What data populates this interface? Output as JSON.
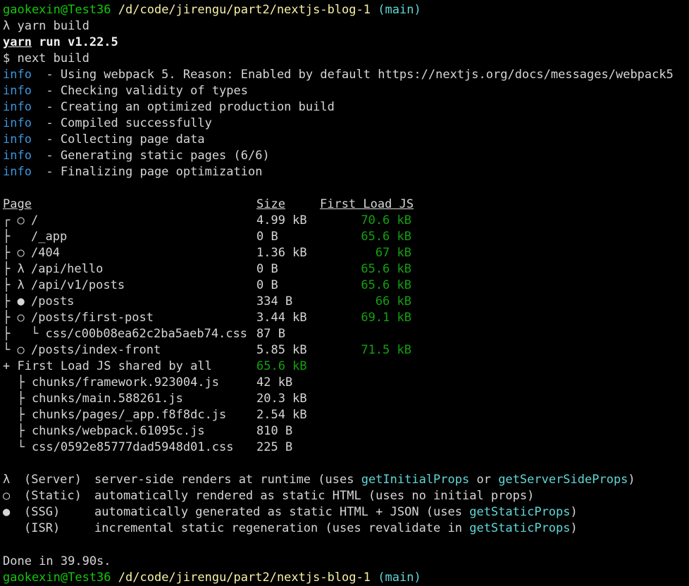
{
  "prompt1": {
    "user": "gaokexin@Test36",
    "path": "/d/code/jirengu/part2/nextjs-blog-1",
    "branch": "(main)"
  },
  "command": "λ yarn build",
  "yarn_version": {
    "word": "yarn",
    "rest": " run v1.22.5"
  },
  "next_cmd": "$ next build",
  "info_label": "info",
  "info_lines": [
    "  - Using webpack 5. Reason: Enabled by default https://nextjs.org/docs/messages/webpack5",
    "  - Checking validity of types",
    "  - Creating an optimized production build",
    "  - Compiled successfully",
    "  - Collecting page data",
    "  - Generating static pages (6/6)",
    "  - Finalizing page optimization"
  ],
  "table": {
    "headers": {
      "page": "Page",
      "size": "Size",
      "first_load": "First Load JS"
    },
    "rows": [
      {
        "tree": "┌ ○ ",
        "page": "/",
        "size": "4.99 kB",
        "load": "70.6 kB"
      },
      {
        "tree": "├   ",
        "page": "/_app",
        "size": "0 B",
        "load": "65.6 kB"
      },
      {
        "tree": "├ ○ ",
        "page": "/404",
        "size": "1.36 kB",
        "load": "67 kB"
      },
      {
        "tree": "├ λ ",
        "page": "/api/hello",
        "size": "0 B",
        "load": "65.6 kB"
      },
      {
        "tree": "├ λ ",
        "page": "/api/v1/posts",
        "size": "0 B",
        "load": "65.6 kB"
      },
      {
        "tree": "├ ● ",
        "page": "/posts",
        "size": "334 B",
        "load": "66 kB"
      },
      {
        "tree": "├ ○ ",
        "page": "/posts/first-post",
        "size": "3.44 kB",
        "load": "69.1 kB"
      },
      {
        "tree": "├   ",
        "page": "└ css/c00b08ea62c2ba5aeb74.css",
        "size": "87 B",
        "load": ""
      },
      {
        "tree": "└ ○ ",
        "page": "/posts/index-front",
        "size": "5.85 kB",
        "load": "71.5 kB"
      }
    ],
    "shared_label": "+ First Load JS shared by all",
    "shared_size": "65.6 kB",
    "chunks": [
      {
        "name": "  ├ chunks/framework.923004.js",
        "size": "42 kB"
      },
      {
        "name": "  ├ chunks/main.588261.js",
        "size": "20.3 kB"
      },
      {
        "name": "  ├ chunks/pages/_app.f8f8dc.js",
        "size": "2.54 kB"
      },
      {
        "name": "  ├ chunks/webpack.61095c.js",
        "size": "810 B"
      },
      {
        "name": "  └ css/0592e85777dad5948d01.css",
        "size": "225 B"
      }
    ]
  },
  "legend": [
    {
      "sym": "λ",
      "kind": "(Server)",
      "desc": "server-side renders at runtime (uses ",
      "link1": "getInitialProps",
      "mid": " or ",
      "link2": "getServerSideProps",
      "end": ")"
    },
    {
      "sym": "○",
      "kind": "(Static)",
      "desc": "automatically rendered as static HTML (uses no initial props)",
      "link1": "",
      "mid": "",
      "link2": "",
      "end": ""
    },
    {
      "sym": "●",
      "kind": "(SSG)",
      "desc": "automatically generated as static HTML + JSON (uses ",
      "link1": "getStaticProps",
      "mid": "",
      "link2": "",
      "end": ")"
    },
    {
      "sym": " ",
      "kind": "(ISR)",
      "desc": "incremental static regeneration (uses revalidate in ",
      "link1": "getStaticProps",
      "mid": "",
      "link2": "",
      "end": ")"
    }
  ],
  "done": "Done in 39.90s.",
  "prompt2": {
    "user": "gaokexin@Test36",
    "path": "/d/code/jirengu/part2/nextjs-blog-1",
    "branch": "(main)"
  }
}
